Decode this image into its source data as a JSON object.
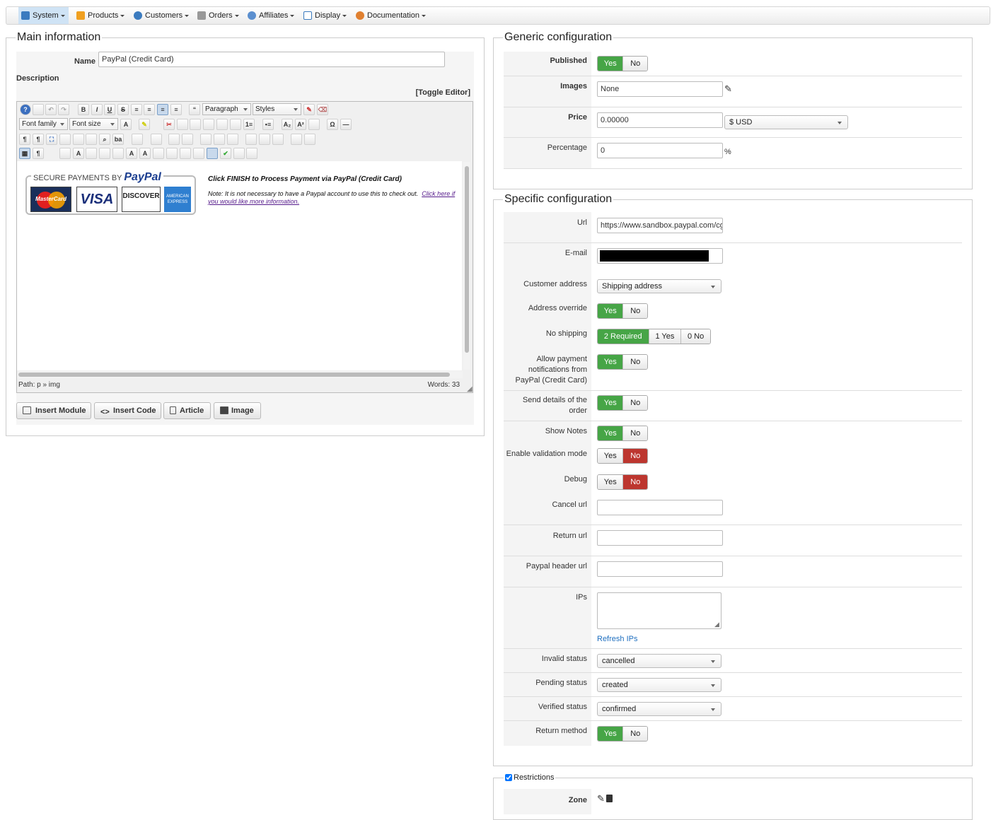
{
  "menu": [
    {
      "label": "System",
      "active": true,
      "icon": "wrench-icon",
      "color": "#3b7bbf"
    },
    {
      "label": "Products",
      "icon": "box-icon",
      "color": "#f0a020"
    },
    {
      "label": "Customers",
      "icon": "users-icon",
      "color": "#3b7bbf"
    },
    {
      "label": "Orders",
      "icon": "cart-icon",
      "color": "#888"
    },
    {
      "label": "Affiliates",
      "icon": "people-icon",
      "color": "#3b7bbf"
    },
    {
      "label": "Display",
      "icon": "display-icon",
      "color": "#3b7bbf"
    },
    {
      "label": "Documentation",
      "icon": "gears-icon",
      "color": "#e08030"
    }
  ],
  "main": {
    "legend": "Main information",
    "name_label": "Name",
    "name_value": "PayPal (Credit Card)",
    "description_label": "Description",
    "toggle_editor": "[Toggle Editor]",
    "paragraph": "Paragraph",
    "styles": "Styles",
    "font_family": "Font family",
    "font_size": "Font size",
    "content": {
      "secure": "SECURE PAYMENTS BY",
      "paypal": "PayPal",
      "cards": [
        "MasterCard",
        "VISA",
        "DISCOVER",
        "AMERICAN EXPRESS"
      ],
      "finish": "Click FINISH to Process Payment via PayPal (Credit Card)",
      "note": "Note: It is not necessary to have a Paypal account to use this to check out.",
      "note_link": "Click here if you would like more information."
    },
    "path": "Path:  p » img",
    "words": "Words: 33",
    "buttons": [
      "Insert Module",
      "Insert Code",
      "Article",
      "Image"
    ]
  },
  "generic": {
    "legend": "Generic configuration",
    "published_label": "Published",
    "images_label": "Images",
    "images_value": "None",
    "price_label": "Price",
    "price_value": "0.00000",
    "currency": "$ USD",
    "percentage_label": "Percentage",
    "percentage_value": "0",
    "percent_sign": "%",
    "yes": "Yes",
    "no": "No"
  },
  "specific": {
    "legend": "Specific configuration",
    "url_label": "Url",
    "url_value": "https://www.sandbox.paypal.com/cgi",
    "email_label": "E-mail",
    "customer_address_label": "Customer address",
    "customer_address_value": "Shipping address",
    "address_override_label": "Address override",
    "no_shipping_label": "No shipping",
    "no_shipping_options": [
      "2 Required",
      "1 Yes",
      "0 No"
    ],
    "allow_notif_label_1": "Allow payment",
    "allow_notif_label_2": "notifications from",
    "allow_notif_label_3": "PayPal (Credit Card)",
    "send_details_label_1": "Send details of the",
    "send_details_label_2": "order",
    "show_notes_label": "Show Notes",
    "validation_label": "Enable validation mode",
    "debug_label": "Debug",
    "cancel_url_label": "Cancel url",
    "return_url_label": "Return url",
    "paypal_header_label": "Paypal header url",
    "ips_label": "IPs",
    "refresh_ips": "Refresh IPs",
    "invalid_status_label": "Invalid status",
    "invalid_status_value": "cancelled",
    "pending_status_label": "Pending status",
    "pending_status_value": "created",
    "verified_status_label": "Verified status",
    "verified_status_value": "confirmed",
    "return_method_label": "Return method",
    "yes": "Yes",
    "no": "No"
  },
  "restrictions": {
    "legend": "Restrictions",
    "checked": true,
    "zone_label": "Zone"
  }
}
